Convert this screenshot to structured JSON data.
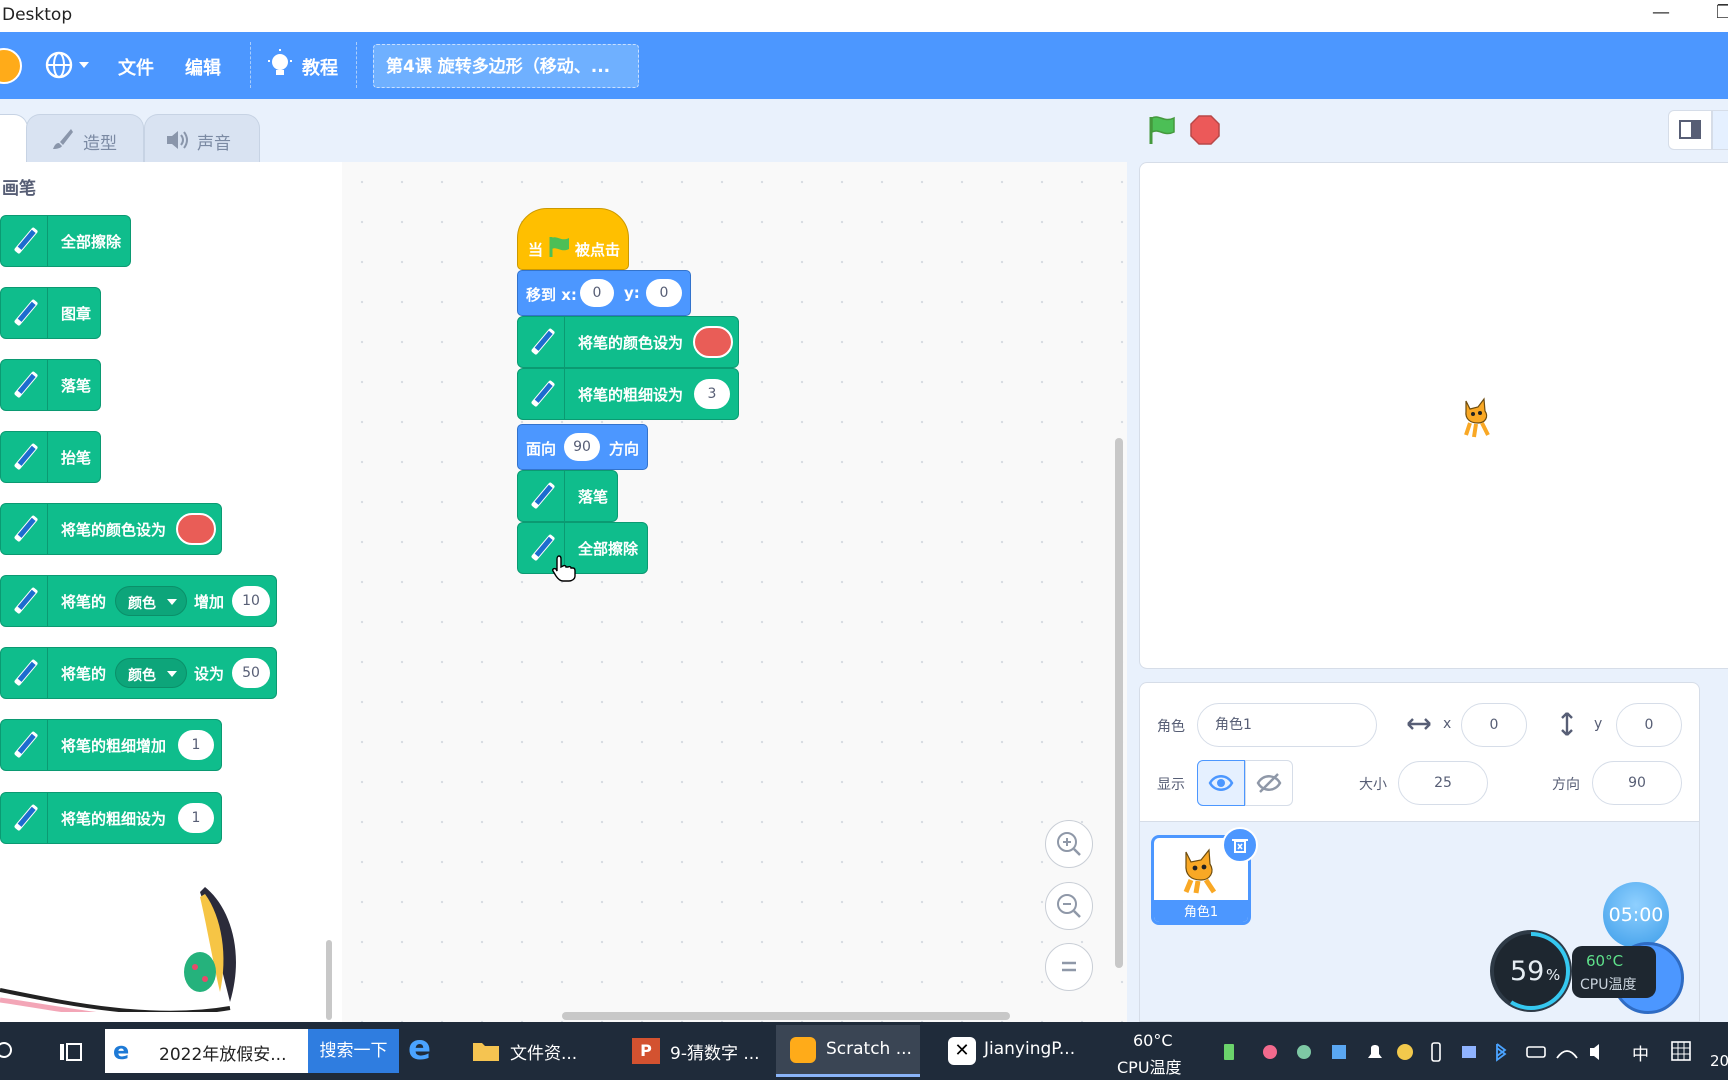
{
  "window": {
    "title": "Desktop",
    "minimize": "—",
    "restore": "❐"
  },
  "menubar": {
    "file": "文件",
    "edit": "编辑",
    "tutorials": "教程",
    "project_title": "第4课 旋转多边形（移动、..."
  },
  "tabs": {
    "costumes": "造型",
    "sounds": "声音"
  },
  "palette": {
    "category": "画笔",
    "blocks": [
      {
        "label": "全部擦除"
      },
      {
        "label": "图章"
      },
      {
        "label": "落笔"
      },
      {
        "label": "抬笔"
      },
      {
        "label": "将笔的颜色设为"
      },
      {
        "label": "将笔的",
        "dropdown": "颜色",
        "label2": "增加",
        "value": "10"
      },
      {
        "label": "将笔的",
        "dropdown": "颜色",
        "label2": "设为",
        "value": "50"
      },
      {
        "label": "将笔的粗细增加",
        "value": "1"
      },
      {
        "label": "将笔的粗细设为",
        "value": "1"
      }
    ]
  },
  "script": {
    "hat": {
      "when": "当",
      "clicked": "被点击"
    },
    "goto": {
      "label": "移到 x:",
      "x": "0",
      "y_label": "y:",
      "y": "0"
    },
    "set_color": {
      "label": "将笔的颜色设为"
    },
    "set_size": {
      "label": "将笔的粗细设为",
      "value": "3"
    },
    "point": {
      "label": "面向",
      "value": "90",
      "suffix": "方向"
    },
    "pen_down": {
      "label": "落笔"
    },
    "clear": {
      "label": "全部擦除"
    }
  },
  "sprite_info": {
    "sprite_label": "角色",
    "sprite_name": "角色1",
    "x_label": "x",
    "x": "0",
    "y_label": "y",
    "y": "0",
    "show_label": "显示",
    "size_label": "大小",
    "size": "25",
    "direction_label": "方向",
    "direction": "90"
  },
  "sprite_list": [
    {
      "name": "角色1"
    }
  ],
  "overlay": {
    "timer": "05:00",
    "cpu_usage": "59",
    "cpu_usage_unit": "%",
    "cpu_temp": "60°C",
    "cpu_temp_label": "CPU温度"
  },
  "taskbar": {
    "browser_tab": "2022年放假安...",
    "search_button": "搜索一下",
    "apps": [
      "文件资...",
      "9-猜数字 ...",
      "Scratch ...",
      "JianyingP..."
    ],
    "temp": "60°C",
    "temp_label": "CPU温度",
    "ime": "中",
    "clock_partial": "20"
  },
  "colors": {
    "menubar": "#4c97ff",
    "pen_block": "#0fbd8c",
    "motion_block": "#4c97ff",
    "events_block": "#ffbf00",
    "pen_color_swatch": "#e95d57"
  }
}
